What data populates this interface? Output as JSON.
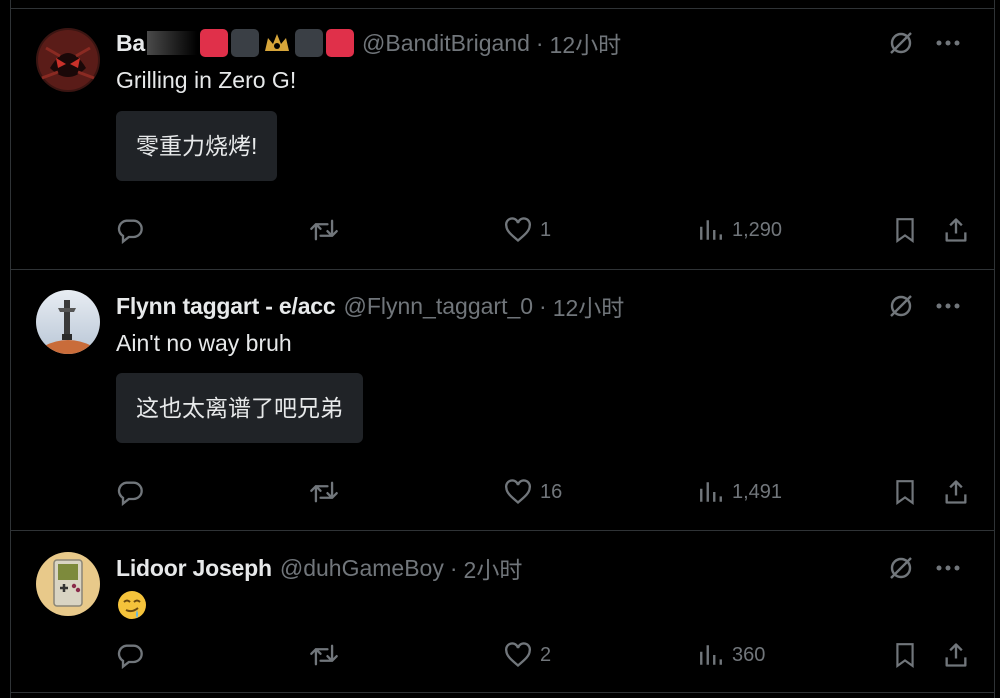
{
  "tweets": [
    {
      "name": "Ba",
      "handle": "@BanditBrigand",
      "time": "12小时",
      "text": "Grilling in Zero G!",
      "translation": "零重力烧烤!",
      "stats": {
        "replies": "",
        "retweets": "",
        "likes": "1",
        "views": "1,290"
      }
    },
    {
      "name": "Flynn taggart - e/acc",
      "handle": "@Flynn_taggart_0",
      "time": "12小时",
      "text": "Ain't no way bruh",
      "translation": "这也太离谱了吧兄弟",
      "stats": {
        "replies": "",
        "retweets": "",
        "likes": "16",
        "views": "1,491"
      }
    },
    {
      "name": "Lidoor Joseph",
      "handle": "@duhGameBoy",
      "time": "2小时",
      "text": "",
      "translation": "",
      "stats": {
        "replies": "",
        "retweets": "",
        "likes": "2",
        "views": "360"
      }
    }
  ],
  "separator": "·",
  "icons": [
    "reply-icon",
    "retweet-icon",
    "like-icon",
    "views-icon",
    "bookmark-icon",
    "share-icon",
    "grok-icon",
    "more-icon"
  ],
  "colors": {
    "background": "#000000",
    "text": "#e7e9ea",
    "muted": "#71767b",
    "divider": "#2f3336",
    "translation_bg": "#202327",
    "badge_red": "#e0304a",
    "badge_gray": "#3a3f45"
  }
}
